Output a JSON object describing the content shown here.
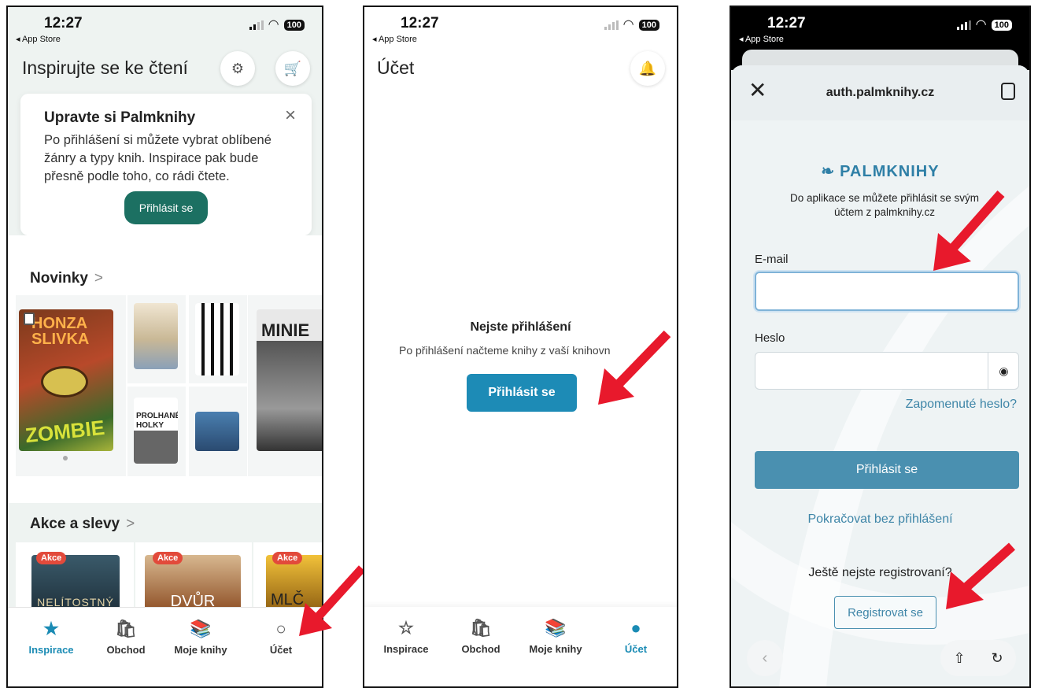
{
  "status": {
    "time": "12:27",
    "back_app": "◂ App Store",
    "battery": "100"
  },
  "p1": {
    "title": "Inspirujte se ke čtení",
    "promo": {
      "title": "Upravte si Palmknihy",
      "text": "Po přihlášení si můžete vybrat oblíbené žánry a typy knih. Inspirace pak bude přesně podle toho, co rádi čtete.",
      "button": "Přihlásit se",
      "close": "×"
    },
    "section_new": "Novinky",
    "section_sale": "Akce a slevy",
    "chevron": ">",
    "books": {
      "zombie_top": "HONZA SLIVKA",
      "zombie_bottom": "ZOMBIE",
      "minie": "MINIE",
      "prolhane": "PROLHANÉ HOLKY",
      "nelitostny": "NELÍTOSTNÝ",
      "dvur": "DVŮR",
      "mlc": "MLČ"
    },
    "sale_badge": "Akce"
  },
  "p2": {
    "title": "Účet",
    "empty_title": "Nejste přihlášení",
    "empty_text": "Po přihlášení načteme knihy z vaší knihovn",
    "button": "Přihlásit se"
  },
  "tabs": [
    {
      "label": "Inspirace",
      "icon": "★"
    },
    {
      "label": "Obchod",
      "icon": "🛍"
    },
    {
      "label": "Moje knihy",
      "icon": "📚"
    },
    {
      "label": "Účet",
      "icon": "👤"
    }
  ],
  "p3": {
    "url": "auth.palmknihy.cz",
    "logo": "PALMKNIHY",
    "subtitle": "Do aplikace se můžete přihlásit se svým účtem z palmknihy.cz",
    "email_label": "E-mail",
    "email_value": "",
    "password_label": "Heslo",
    "password_value": "",
    "forgot": "Zapomenuté heslo?",
    "login_button": "Přihlásit se",
    "continue": "Pokračovat bez přihlášení",
    "not_registered": "Ještě nejste registrovaní?",
    "register_button": "Registrovat se"
  },
  "colors": {
    "accent_green": "#1c7062",
    "accent_blue": "#1a8bb4",
    "login_blue": "#4a90b0",
    "arrow_red": "#e8192c"
  }
}
